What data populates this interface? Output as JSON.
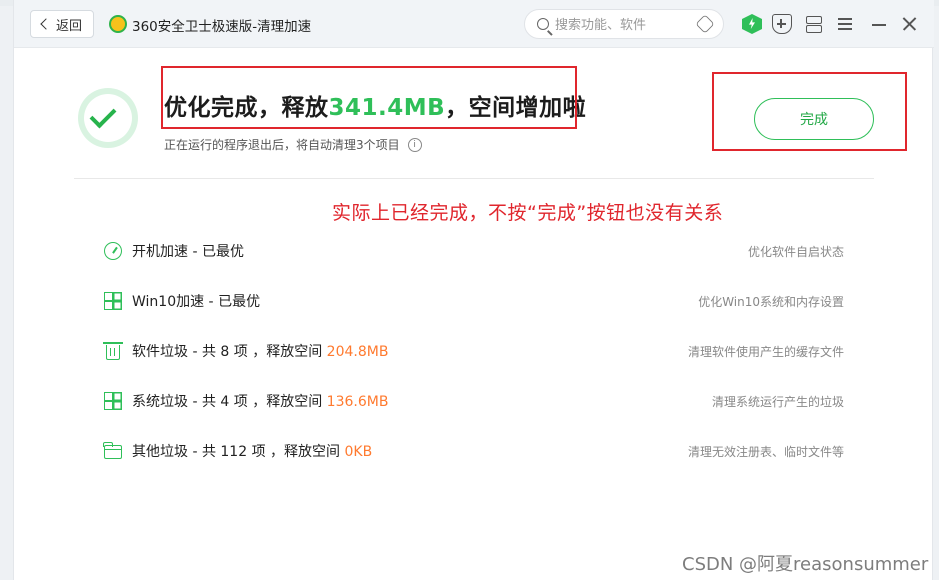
{
  "window": {
    "back_label": "返回",
    "app_title": "360安全卫士极速版-清理加速"
  },
  "search": {
    "placeholder": "搜索功能、软件"
  },
  "result": {
    "headline_prefix": "优化完成，释放",
    "headline_amount": "341.4MB",
    "headline_suffix": "，空间增加啦",
    "subline": "正在运行的程序退出后，将自动清理3个项目",
    "info_glyph": "i",
    "finish_label": "完成"
  },
  "annotation": {
    "note": "实际上已经完成，不按“完成”按钮也没有关系"
  },
  "items": [
    {
      "icon": "gauge-icon",
      "label": "开机加速 - 已最优",
      "amount": "",
      "desc": "优化软件自启状态"
    },
    {
      "icon": "windows-icon",
      "label": "Win10加速 - 已最优",
      "amount": "",
      "desc": "优化Win10系统和内存设置"
    },
    {
      "icon": "trash-icon",
      "label": "软件垃圾 - 共 8 项 ，释放空间 ",
      "amount": "204.8MB",
      "desc": "清理软件使用产生的缓存文件"
    },
    {
      "icon": "windows-icon",
      "label": "系统垃圾 - 共 4 项 ，释放空间 ",
      "amount": "136.6MB",
      "desc": "清理系统运行产生的垃圾"
    },
    {
      "icon": "folder-icon",
      "label": "其他垃圾 - 共 112 项 ，释放空间 ",
      "amount": "0KB",
      "desc": "清理无效注册表、临时文件等"
    }
  ],
  "watermark": "CSDN @阿夏reasonsummer",
  "colors": {
    "accent_green": "#2fbf59",
    "amount_orange": "#ff7a2f",
    "annotation_red": "#e0262d"
  }
}
